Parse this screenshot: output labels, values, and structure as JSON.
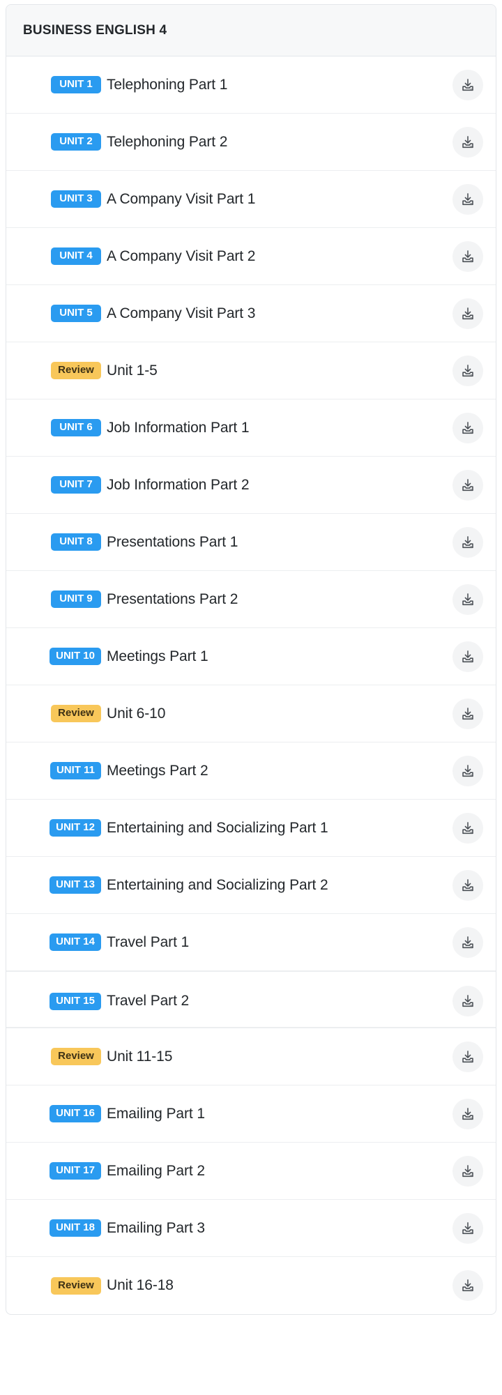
{
  "card": {
    "header": {
      "title": "BUSINESS ENGLISH 4"
    },
    "colors": {
      "unit_badge_bg": "#2a9bf0",
      "unit_badge_text": "#ffffff",
      "review_badge_bg": "#f8c75a",
      "review_badge_text": "#3d3115",
      "row_text": "#23272b",
      "header_bg": "#f7f8f9",
      "card_border": "#e3e6ea",
      "download_button_bg": "#f3f4f5"
    },
    "download_icon_name": "download-icon",
    "rows": [
      {
        "badge": "UNIT 1",
        "badge_type": "unit",
        "title": "Telephoning Part 1",
        "download": "download-icon"
      },
      {
        "badge": "UNIT 2",
        "badge_type": "unit",
        "title": "Telephoning Part 2",
        "download": "download-icon"
      },
      {
        "badge": "UNIT 3",
        "badge_type": "unit",
        "title": "A Company Visit Part 1",
        "download": "download-icon"
      },
      {
        "badge": "UNIT 4",
        "badge_type": "unit",
        "title": "A Company Visit Part 2",
        "download": "download-icon"
      },
      {
        "badge": "UNIT 5",
        "badge_type": "unit",
        "title": "A Company Visit Part 3",
        "download": "download-icon"
      },
      {
        "badge": "Review",
        "badge_type": "review",
        "title": "Unit 1-5",
        "download": "download-icon"
      },
      {
        "badge": "UNIT 6",
        "badge_type": "unit",
        "title": "Job Information Part 1",
        "download": "download-icon"
      },
      {
        "badge": "UNIT 7",
        "badge_type": "unit",
        "title": "Job Information Part 2",
        "download": "download-icon"
      },
      {
        "badge": "UNIT 8",
        "badge_type": "unit",
        "title": "Presentations Part 1",
        "download": "download-icon"
      },
      {
        "badge": "UNIT 9",
        "badge_type": "unit",
        "title": "Presentations Part 2",
        "download": "download-icon"
      },
      {
        "badge": "UNIT 10",
        "badge_type": "unit",
        "title": "Meetings Part 1",
        "download": "download-icon"
      },
      {
        "badge": "Review",
        "badge_type": "review",
        "title": "Unit 6-10",
        "download": "download-icon"
      },
      {
        "badge": "UNIT 11",
        "badge_type": "unit",
        "title": "Meetings Part 2",
        "download": "download-icon"
      },
      {
        "badge": "UNIT 12",
        "badge_type": "unit",
        "title": "Entertaining and Socializing Part 1",
        "download": "download-icon"
      },
      {
        "badge": "UNIT 13",
        "badge_type": "unit",
        "title": "Entertaining and Socializing Part 2",
        "download": "download-icon"
      },
      {
        "badge": "UNIT 14",
        "badge_type": "unit",
        "title": "Travel Part 1",
        "download": "download-icon"
      },
      {
        "badge": "UNIT 15",
        "badge_type": "unit",
        "title": "Travel Part 2",
        "download": "download-icon",
        "section_break": true
      },
      {
        "badge": "Review",
        "badge_type": "review",
        "title": "Unit 11-15",
        "download": "download-icon"
      },
      {
        "badge": "UNIT 16",
        "badge_type": "unit",
        "title": "Emailing Part 1",
        "download": "download-icon"
      },
      {
        "badge": "UNIT 17",
        "badge_type": "unit",
        "title": "Emailing Part 2",
        "download": "download-icon"
      },
      {
        "badge": "UNIT 18",
        "badge_type": "unit",
        "title": "Emailing Part 3",
        "download": "download-icon"
      },
      {
        "badge": "Review",
        "badge_type": "review",
        "title": "Unit 16-18",
        "download": "download-icon"
      }
    ]
  }
}
